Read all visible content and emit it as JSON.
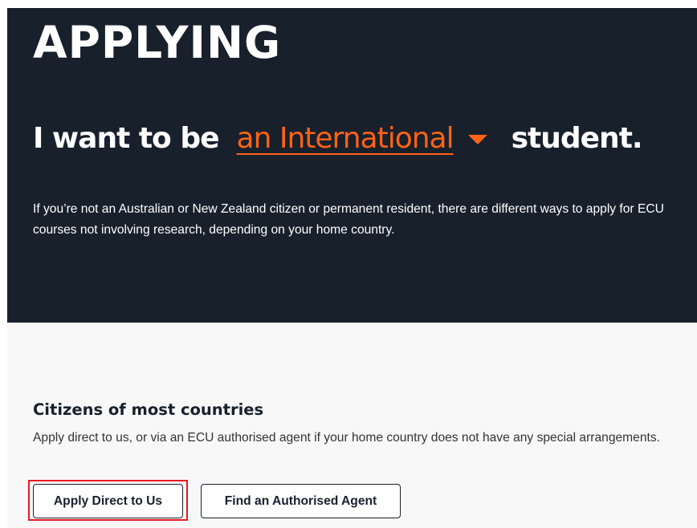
{
  "hero": {
    "title": "APPLYING",
    "selector_prefix": "I want to be",
    "selector_value": "an International",
    "selector_suffix": "student.",
    "description": "If you’re not an Australian or New Zealand citizen or permanent resident, there are different ways to apply for ECU courses not involving research, depending on your home country.",
    "caret_icon": "caret-down-icon"
  },
  "section": {
    "title": "Citizens of most countries",
    "description": "Apply direct to us, or via an ECU authorised agent if your home country does not have any special arrangements.",
    "buttons": {
      "apply_direct": "Apply Direct to Us",
      "find_agent": "Find an Authorised Agent"
    }
  },
  "colors": {
    "hero_background": "#18202c",
    "accent": "#ff6316",
    "highlight": "#e31b23",
    "content_background": "#f8f8f8"
  }
}
